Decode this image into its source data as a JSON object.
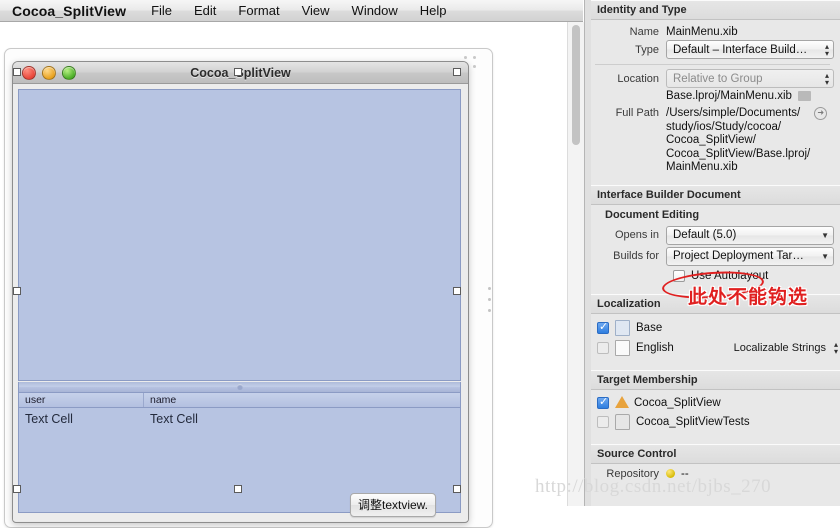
{
  "menubar": {
    "app": "Cocoa_SplitView",
    "items": [
      "File",
      "Edit",
      "Format",
      "View",
      "Window",
      "Help"
    ]
  },
  "window": {
    "title": "Cocoa_SplitView",
    "table": {
      "columns": [
        "user",
        "name"
      ],
      "rows": [
        [
          "Text Cell",
          "Text Cell"
        ]
      ]
    },
    "adjust_button": "调整textview."
  },
  "inspector": {
    "identity": {
      "section": "Identity and Type",
      "name_label": "Name",
      "name_value": "MainMenu.xib",
      "type_label": "Type",
      "type_value": "Default – Interface Build…",
      "location_label": "Location",
      "location_value": "Relative to Group",
      "relative_path": "Base.lproj/MainMenu.xib",
      "full_path_label": "Full Path",
      "full_path_lines": [
        "/Users/simple/Documents/",
        "study/ios/Study/cocoa/",
        "Cocoa_SplitView/",
        "Cocoa_SplitView/Base.lproj/",
        "MainMenu.xib"
      ]
    },
    "ib_document": {
      "section": "Interface Builder Document",
      "sub_section": "Document Editing",
      "opens_in_label": "Opens in",
      "opens_in_value": "Default (5.0)",
      "builds_for_label": "Builds for",
      "builds_for_value": "Project Deployment Tar…",
      "autolayout_label": "Use Autolayout",
      "autolayout_checked": false
    },
    "localization": {
      "section": "Localization",
      "items": [
        {
          "label": "Base",
          "checked": true,
          "type": ""
        },
        {
          "label": "English",
          "checked": false,
          "type": "Localizable Strings"
        }
      ]
    },
    "target_membership": {
      "section": "Target Membership",
      "items": [
        {
          "label": "Cocoa_SplitView",
          "checked": true
        },
        {
          "label": "Cocoa_SplitViewTests",
          "checked": false
        }
      ]
    },
    "source_control": {
      "section": "Source Control",
      "repository_label": "Repository",
      "repository_value": "--"
    }
  },
  "annotation": {
    "text": "此处不能钩选"
  },
  "watermark": {
    "text": "http://blog.csdn.net/bjbs_270"
  },
  "colors": {
    "canvas_fill": "#b7c4e2",
    "canvas_border": "#8b9bc4",
    "accent_red": "#e02020",
    "checkbox_blue": "#2f7fe0"
  }
}
